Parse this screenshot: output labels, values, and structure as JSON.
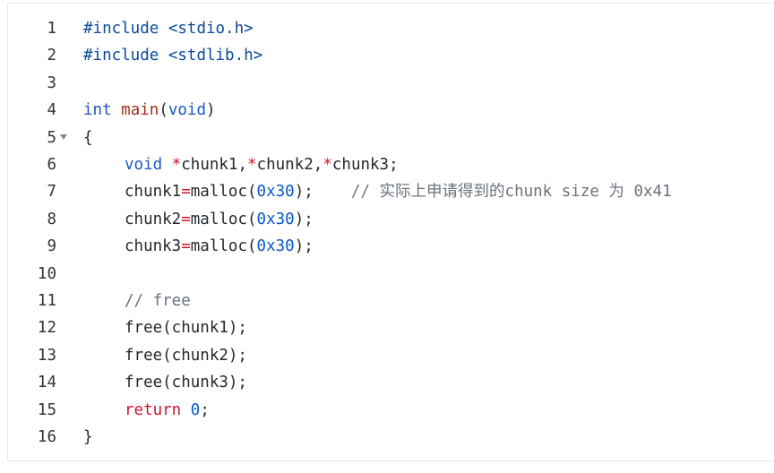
{
  "lines": [
    {
      "num": "1",
      "tokens": [
        [
          "#include",
          "meta"
        ],
        [
          " <stdio.h>",
          "meta"
        ]
      ]
    },
    {
      "num": "2",
      "tokens": [
        [
          "#include",
          "meta"
        ],
        [
          " <stdlib.h>",
          "meta"
        ]
      ]
    },
    {
      "num": "3",
      "tokens": []
    },
    {
      "num": "4",
      "tokens": [
        [
          "int",
          "kw"
        ],
        [
          " ",
          "plain"
        ],
        [
          "main",
          "fn"
        ],
        [
          "(",
          "plain"
        ],
        [
          "void",
          "kw"
        ],
        [
          ")",
          "plain"
        ]
      ]
    },
    {
      "num": "5",
      "fold": true,
      "tokens": [
        [
          "{",
          "plain"
        ]
      ]
    },
    {
      "num": "6",
      "indent": 1,
      "tokens": [
        [
          "void",
          "kw"
        ],
        [
          " ",
          "plain"
        ],
        [
          "*",
          "red"
        ],
        [
          "chunk1,",
          "plain"
        ],
        [
          "*",
          "red"
        ],
        [
          "chunk2,",
          "plain"
        ],
        [
          "*",
          "red"
        ],
        [
          "chunk3;",
          "plain"
        ]
      ]
    },
    {
      "num": "7",
      "indent": 1,
      "tokens": [
        [
          "chunk1",
          "plain"
        ],
        [
          "=",
          "red"
        ],
        [
          "malloc(",
          "plain"
        ],
        [
          "0x30",
          "num"
        ],
        [
          ");",
          "plain"
        ],
        [
          "    ",
          "plain"
        ],
        [
          "// 实际上申请得到的chunk size 为 0x41",
          "cmt"
        ]
      ]
    },
    {
      "num": "8",
      "indent": 1,
      "tokens": [
        [
          "chunk2",
          "plain"
        ],
        [
          "=",
          "red"
        ],
        [
          "malloc(",
          "plain"
        ],
        [
          "0x30",
          "num"
        ],
        [
          ");",
          "plain"
        ]
      ]
    },
    {
      "num": "9",
      "indent": 1,
      "tokens": [
        [
          "chunk3",
          "plain"
        ],
        [
          "=",
          "red"
        ],
        [
          "malloc(",
          "plain"
        ],
        [
          "0x30",
          "num"
        ],
        [
          ");",
          "plain"
        ]
      ]
    },
    {
      "num": "10",
      "tokens": []
    },
    {
      "num": "11",
      "indent": 1,
      "tokens": [
        [
          "// free",
          "cmt"
        ]
      ]
    },
    {
      "num": "12",
      "indent": 1,
      "tokens": [
        [
          "free(chunk1);",
          "plain"
        ]
      ]
    },
    {
      "num": "13",
      "indent": 1,
      "tokens": [
        [
          "free(chunk2);",
          "plain"
        ]
      ]
    },
    {
      "num": "14",
      "indent": 1,
      "tokens": [
        [
          "free(chunk3);",
          "plain"
        ]
      ]
    },
    {
      "num": "15",
      "indent": 1,
      "tokens": [
        [
          "return",
          "red"
        ],
        [
          " ",
          "plain"
        ],
        [
          "0",
          "num"
        ],
        [
          ";",
          "plain"
        ]
      ]
    },
    {
      "num": "16",
      "tokens": [
        [
          "}",
          "plain"
        ]
      ]
    }
  ],
  "icons": {
    "fold": "fold-arrow-down-icon"
  }
}
